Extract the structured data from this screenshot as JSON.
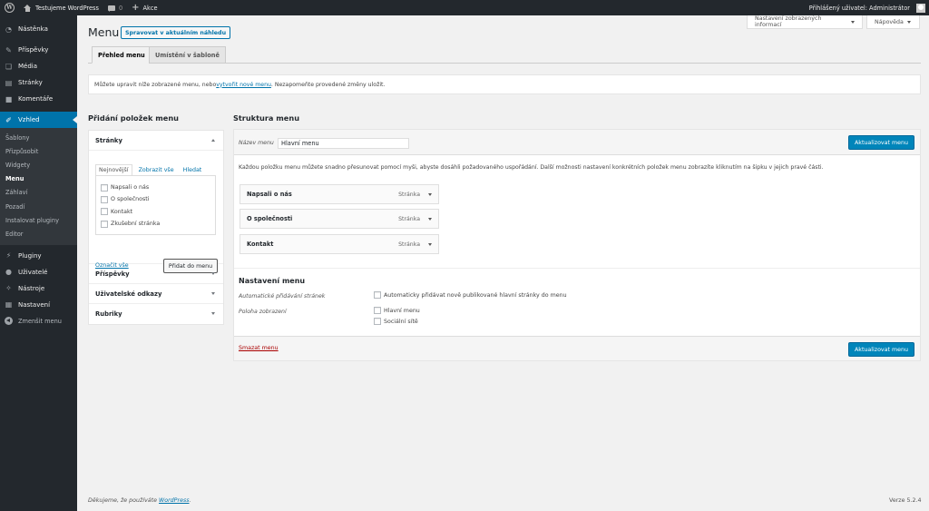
{
  "admin_bar": {
    "site_name": "Testujeme WordPress",
    "comments_count": "0",
    "new_label": "Akce",
    "greeting": "Přihlášený uživatel: Administrátor"
  },
  "sidebar": {
    "items": [
      {
        "label": "Nástěnka",
        "icon": "dashboard-icon",
        "glyph": "◔"
      },
      {
        "label": "Příspěvky",
        "icon": "pin-icon",
        "glyph": "✎"
      },
      {
        "label": "Média",
        "icon": "media-icon",
        "glyph": "❏"
      },
      {
        "label": "Stránky",
        "icon": "page-icon",
        "glyph": "▤"
      },
      {
        "label": "Komentáře",
        "icon": "comment-icon",
        "glyph": "■"
      },
      {
        "label": "Vzhled",
        "icon": "brush-icon",
        "glyph": "✐"
      },
      {
        "label": "Pluginy",
        "icon": "plugin-icon",
        "glyph": "⚡"
      },
      {
        "label": "Uživatelé",
        "icon": "users-icon",
        "glyph": "●"
      },
      {
        "label": "Nástroje",
        "icon": "wrench-icon",
        "glyph": "✧"
      },
      {
        "label": "Nastavení",
        "icon": "settings-icon",
        "glyph": "▦"
      }
    ],
    "submenu": [
      "Šablony",
      "Přizpůsobit",
      "Widgety",
      "Menu",
      "Záhlaví",
      "Pozadí",
      "Instalovat pluginy",
      "Editor"
    ],
    "collapse_label": "Zmenšit menu"
  },
  "screen_options": {
    "label": "Nastavení zobrazených informací",
    "help_label": "Nápověda"
  },
  "header": {
    "title": "Menu",
    "live_button": "Spravovat v aktuálním náhledu"
  },
  "tabs": [
    "Přehled menu",
    "Umístění v šabloně"
  ],
  "notice": {
    "before": "Můžete upravit níže zobrazené menu, nebo ",
    "link": "vytvořit nové menu",
    "after": ". Nezapomeňte provedené změny uložit."
  },
  "left": {
    "title": "Přidání položek menu",
    "pages_section": "Stránky",
    "inner_tabs": [
      "Nejnovější",
      "Zobrazit vše",
      "Hledat"
    ],
    "pages": [
      "Napsali o nás",
      "O společnosti",
      "Kontakt",
      "Zkušební stránka"
    ],
    "select_all": "Označit vše",
    "add_button": "Přidat do menu",
    "sections": [
      "Příspěvky",
      "Uživatelské odkazy",
      "Rubriky"
    ]
  },
  "right": {
    "title": "Struktura menu",
    "name_label": "Název menu",
    "name_value": "Hlavní menu",
    "save_button": "Aktualizovat menu",
    "instructions": "Každou položku menu můžete snadno přesunovat pomocí myši, abyste dosáhli požadovaného uspořádání. Další možnosti nastavení konkrétních položek menu zobrazíte kliknutím na šipku v jejich pravé části.",
    "items": [
      {
        "title": "Napsali o nás",
        "type": "Stránka"
      },
      {
        "title": "O společnosti",
        "type": "Stránka"
      },
      {
        "title": "Kontakt",
        "type": "Stránka"
      }
    ],
    "settings_title": "Nastavení menu",
    "auto_add_label": "Automatické přidávání stránek",
    "auto_add_option": "Automaticky přidávat nově publikované hlavní stránky do menu",
    "location_label": "Poloha zobrazení",
    "locations": [
      "Hlavní menu",
      "Sociální sítě"
    ],
    "delete_link": "Smazat menu"
  },
  "footer": {
    "thanks": "Děkujeme, že používáte ",
    "link": "WordPress",
    "end": ".",
    "version": "Verze 5.2.4"
  }
}
